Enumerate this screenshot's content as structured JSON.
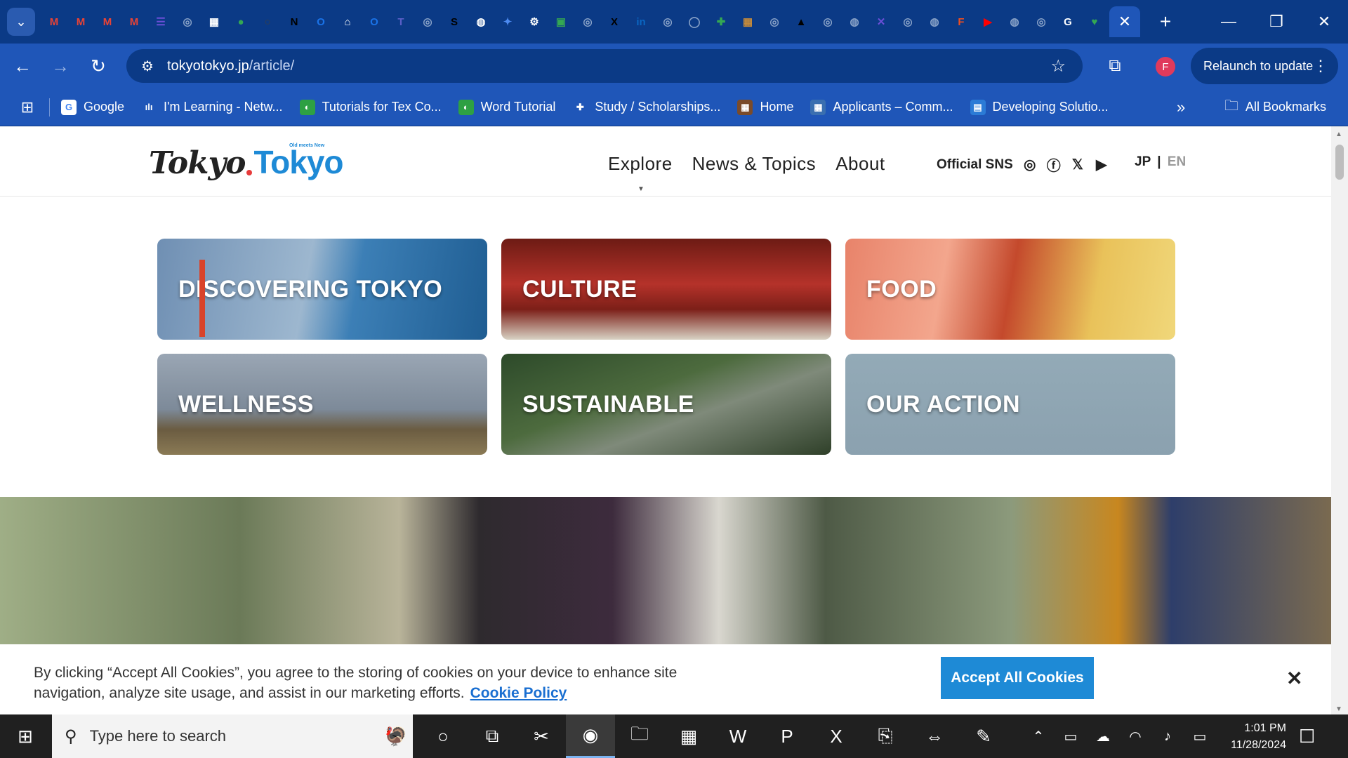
{
  "browser": {
    "favicons": [
      "M",
      "M",
      "M",
      "M",
      "☰",
      "◎",
      "▦",
      "●",
      "○",
      "N",
      "O",
      "⌂",
      "O",
      "T",
      "◎",
      "S",
      "◍",
      "✦",
      "⚙",
      "▣",
      "◎",
      "X",
      "in",
      "◎",
      "◯",
      "✚",
      "▦",
      "◎",
      "▲",
      "◎",
      "◍",
      "✕",
      "◎",
      "◍",
      "F",
      "▶",
      "◍",
      "◎",
      "G",
      "♥"
    ],
    "url_host": "tokyotokyo.jp",
    "url_path": "/article/",
    "profile_initial": "F",
    "relaunch_label": "Relaunch to update",
    "bookmarks": [
      {
        "label": "Google",
        "icon": "G",
        "color": "#ffffff",
        "fg": "#4285f4"
      },
      {
        "label": "I'm Learning - Netw...",
        "icon": "ılı",
        "color": "#1f56b8",
        "fg": "#ffffff"
      },
      {
        "label": "Tutorials for Tex Co...",
        "icon": "◐",
        "color": "#2ea043",
        "fg": "#ffffff"
      },
      {
        "label": "Word Tutorial",
        "icon": "◐",
        "color": "#2ea043",
        "fg": "#ffffff"
      },
      {
        "label": "Study / Scholarships...",
        "icon": "✚",
        "color": "#1f56b8",
        "fg": "#ffffff"
      },
      {
        "label": "Home",
        "icon": "▦",
        "color": "#7a4b2a",
        "fg": "#ffffff"
      },
      {
        "label": "Applicants – Comm...",
        "icon": "▦",
        "color": "#3a6fb0",
        "fg": "#ffffff"
      },
      {
        "label": "Developing Solutio...",
        "icon": "▤",
        "color": "#2b7bd6",
        "fg": "#ffffff"
      }
    ],
    "all_bookmarks_label": "All Bookmarks"
  },
  "site": {
    "logo_part1": "Tokyo",
    "logo_part2": "Tokyo",
    "logo_tagline": "Old meets New",
    "nav": [
      "Explore",
      "News & Topics",
      "About"
    ],
    "sns_label": "Official SNS",
    "sns_icons": [
      "instagram-icon",
      "facebook-icon",
      "x-icon",
      "youtube-icon"
    ],
    "lang_jp": "JP",
    "lang_sep": "|",
    "lang_en": "EN",
    "categories": [
      "DISCOVERING TOKYO",
      "CULTURE",
      "FOOD",
      "WELLNESS",
      "SUSTAINABLE",
      "OUR ACTION"
    ]
  },
  "cookie_banner": {
    "text": "By clicking “Accept All Cookies”, you agree to the storing of cookies on your device to enhance site navigation, analyze site usage, and assist in our marketing efforts.",
    "policy_link": "Cookie Policy",
    "accept_label": "Accept All Cookies",
    "close_glyph": "✕"
  },
  "taskbar": {
    "search_placeholder": "Type here to search",
    "time": "1:01 PM",
    "date": "11/28/2024"
  }
}
